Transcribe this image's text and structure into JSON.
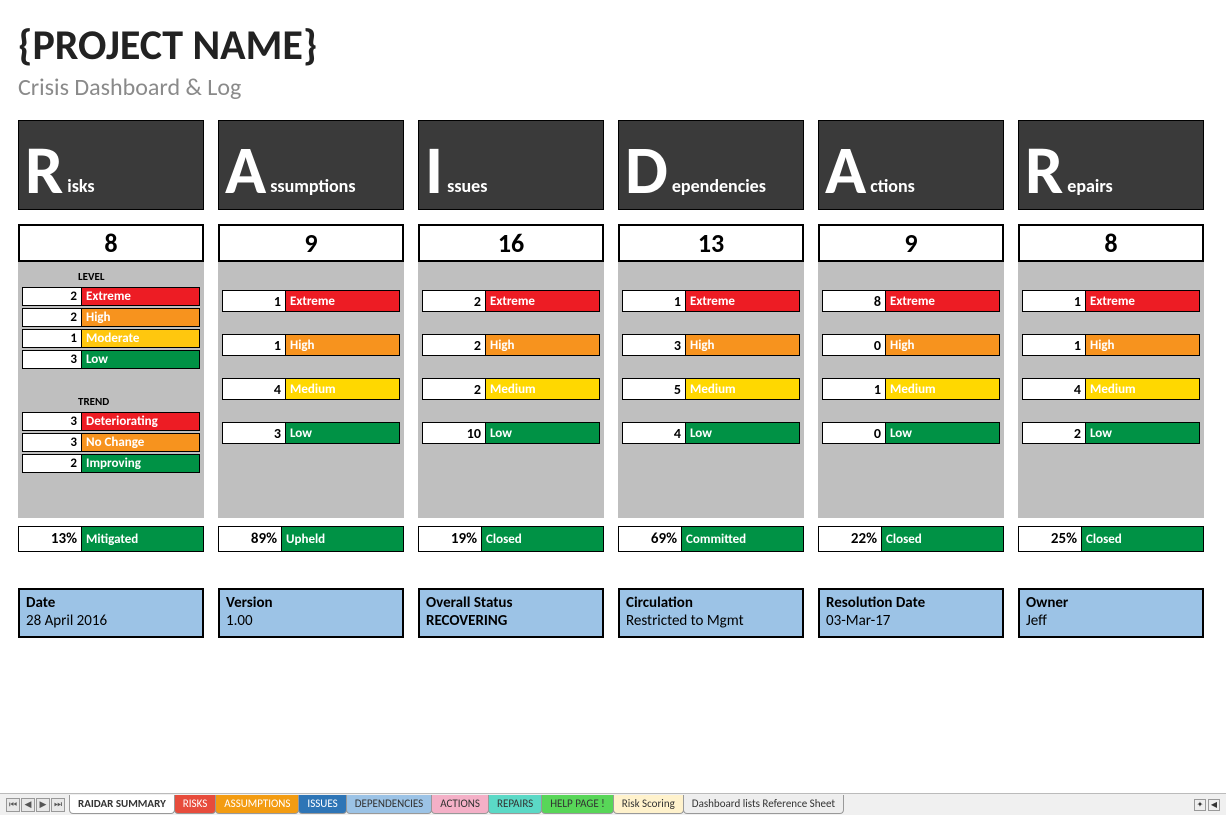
{
  "header": {
    "title": "{PROJECT NAME}",
    "subtitle": "Crisis Dashboard & Log"
  },
  "labels": {
    "level": "LEVEL",
    "trend": "TREND"
  },
  "columns": [
    {
      "letter": "R",
      "rest": "isks",
      "total": "8",
      "type": "risks",
      "levels": [
        {
          "n": "2",
          "label": "Extreme",
          "cls": "c-extreme"
        },
        {
          "n": "2",
          "label": "High",
          "cls": "c-high"
        },
        {
          "n": "1",
          "label": "Moderate",
          "cls": "c-moderate"
        },
        {
          "n": "3",
          "label": "Low",
          "cls": "c-low"
        }
      ],
      "trends": [
        {
          "n": "3",
          "label": "Deteriorating",
          "cls": "c-det"
        },
        {
          "n": "3",
          "label": "No Change",
          "cls": "c-noch"
        },
        {
          "n": "2",
          "label": "Improving",
          "cls": "c-imp"
        }
      ],
      "pct": {
        "n": "13%",
        "label": "Mitigated",
        "cls": "c-green"
      }
    },
    {
      "letter": "A",
      "rest": "ssumptions",
      "total": "9",
      "type": "std",
      "rows": [
        {
          "n": "1",
          "label": "Extreme",
          "cls": "c-extreme"
        },
        {
          "n": "1",
          "label": "High",
          "cls": "c-high"
        },
        {
          "n": "4",
          "label": "Medium",
          "cls": "c-yellow"
        },
        {
          "n": "3",
          "label": "Low",
          "cls": "c-green"
        }
      ],
      "pct": {
        "n": "89%",
        "label": "Upheld",
        "cls": "c-green"
      }
    },
    {
      "letter": "I",
      "rest": "ssues",
      "total": "16",
      "type": "std",
      "rows": [
        {
          "n": "2",
          "label": "Extreme",
          "cls": "c-extreme"
        },
        {
          "n": "2",
          "label": "High",
          "cls": "c-high"
        },
        {
          "n": "2",
          "label": "Medium",
          "cls": "c-yellow"
        },
        {
          "n": "10",
          "label": "Low",
          "cls": "c-green"
        }
      ],
      "pct": {
        "n": "19%",
        "label": "Closed",
        "cls": "c-green"
      }
    },
    {
      "letter": "D",
      "rest": "ependencies",
      "total": "13",
      "type": "std",
      "rows": [
        {
          "n": "1",
          "label": "Extreme",
          "cls": "c-extreme"
        },
        {
          "n": "3",
          "label": "High",
          "cls": "c-high"
        },
        {
          "n": "5",
          "label": "Medium",
          "cls": "c-yellow"
        },
        {
          "n": "4",
          "label": "Low",
          "cls": "c-green"
        }
      ],
      "pct": {
        "n": "69%",
        "label": "Committed",
        "cls": "c-green"
      }
    },
    {
      "letter": "A",
      "rest": "ctions",
      "total": "9",
      "type": "std",
      "rows": [
        {
          "n": "8",
          "label": "Extreme",
          "cls": "c-extreme"
        },
        {
          "n": "0",
          "label": "High",
          "cls": "c-high"
        },
        {
          "n": "1",
          "label": "Medium",
          "cls": "c-yellow"
        },
        {
          "n": "0",
          "label": "Low",
          "cls": "c-green"
        }
      ],
      "pct": {
        "n": "22%",
        "label": "Closed",
        "cls": "c-green"
      }
    },
    {
      "letter": "R",
      "rest": "epairs",
      "total": "8",
      "type": "std",
      "rows": [
        {
          "n": "1",
          "label": "Extreme",
          "cls": "c-extreme"
        },
        {
          "n": "1",
          "label": "High",
          "cls": "c-high"
        },
        {
          "n": "4",
          "label": "Medium",
          "cls": "c-yellow"
        },
        {
          "n": "2",
          "label": "Low",
          "cls": "c-green"
        }
      ],
      "pct": {
        "n": "25%",
        "label": "Closed",
        "cls": "c-green"
      }
    }
  ],
  "info": [
    {
      "label": "Date",
      "value": "28 April 2016",
      "bold": false
    },
    {
      "label": "Version",
      "value": "1.00",
      "bold": false
    },
    {
      "label": "Overall Status",
      "value": "RECOVERING",
      "bold": true
    },
    {
      "label": "Circulation",
      "value": "Restricted to Mgmt",
      "bold": false
    },
    {
      "label": "Resolution Date",
      "value": "03-Mar-17",
      "bold": false
    },
    {
      "label": "Owner",
      "value": "Jeff",
      "bold": false
    }
  ],
  "tabs": [
    {
      "name": "RAIDAR SUMMARY",
      "cls": "active"
    },
    {
      "name": "RISKS",
      "cls": "red"
    },
    {
      "name": "ASSUMPTIONS",
      "cls": "orange"
    },
    {
      "name": "ISSUES",
      "cls": "blue"
    },
    {
      "name": "DEPENDENCIES",
      "cls": "lblue"
    },
    {
      "name": "ACTIONS",
      "cls": "pink"
    },
    {
      "name": "REPAIRS",
      "cls": "teal"
    },
    {
      "name": "HELP PAGE !",
      "cls": "green"
    },
    {
      "name": "Risk Scoring",
      "cls": "cream"
    },
    {
      "name": "Dashboard lists Reference Sheet",
      "cls": ""
    }
  ]
}
